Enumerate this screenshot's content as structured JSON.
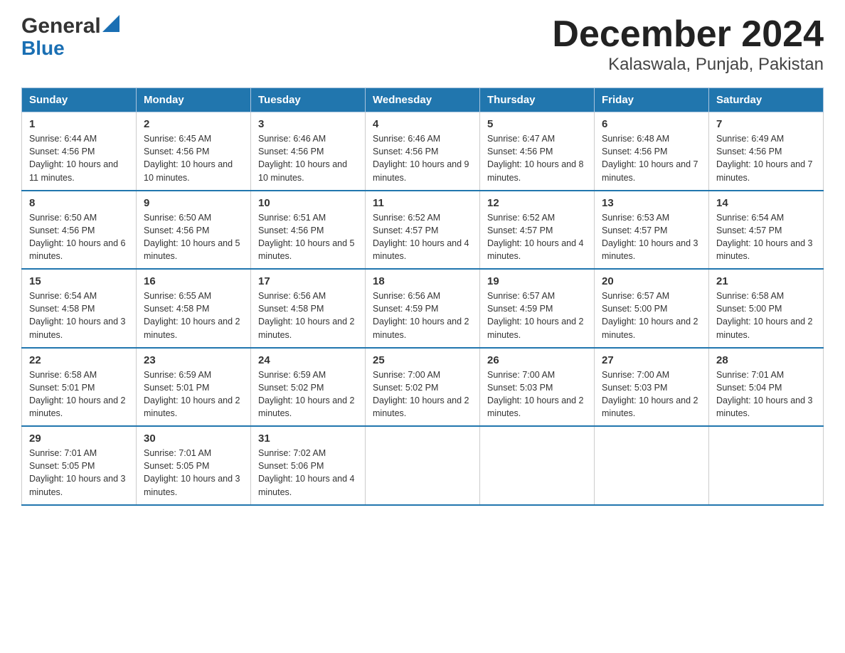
{
  "header": {
    "logo_general": "General",
    "logo_blue": "Blue",
    "title": "December 2024",
    "subtitle": "Kalaswala, Punjab, Pakistan"
  },
  "weekdays": [
    "Sunday",
    "Monday",
    "Tuesday",
    "Wednesday",
    "Thursday",
    "Friday",
    "Saturday"
  ],
  "weeks": [
    [
      {
        "day": "1",
        "sunrise": "6:44 AM",
        "sunset": "4:56 PM",
        "daylight": "10 hours and 11 minutes."
      },
      {
        "day": "2",
        "sunrise": "6:45 AM",
        "sunset": "4:56 PM",
        "daylight": "10 hours and 10 minutes."
      },
      {
        "day": "3",
        "sunrise": "6:46 AM",
        "sunset": "4:56 PM",
        "daylight": "10 hours and 10 minutes."
      },
      {
        "day": "4",
        "sunrise": "6:46 AM",
        "sunset": "4:56 PM",
        "daylight": "10 hours and 9 minutes."
      },
      {
        "day": "5",
        "sunrise": "6:47 AM",
        "sunset": "4:56 PM",
        "daylight": "10 hours and 8 minutes."
      },
      {
        "day": "6",
        "sunrise": "6:48 AM",
        "sunset": "4:56 PM",
        "daylight": "10 hours and 7 minutes."
      },
      {
        "day": "7",
        "sunrise": "6:49 AM",
        "sunset": "4:56 PM",
        "daylight": "10 hours and 7 minutes."
      }
    ],
    [
      {
        "day": "8",
        "sunrise": "6:50 AM",
        "sunset": "4:56 PM",
        "daylight": "10 hours and 6 minutes."
      },
      {
        "day": "9",
        "sunrise": "6:50 AM",
        "sunset": "4:56 PM",
        "daylight": "10 hours and 5 minutes."
      },
      {
        "day": "10",
        "sunrise": "6:51 AM",
        "sunset": "4:56 PM",
        "daylight": "10 hours and 5 minutes."
      },
      {
        "day": "11",
        "sunrise": "6:52 AM",
        "sunset": "4:57 PM",
        "daylight": "10 hours and 4 minutes."
      },
      {
        "day": "12",
        "sunrise": "6:52 AM",
        "sunset": "4:57 PM",
        "daylight": "10 hours and 4 minutes."
      },
      {
        "day": "13",
        "sunrise": "6:53 AM",
        "sunset": "4:57 PM",
        "daylight": "10 hours and 3 minutes."
      },
      {
        "day": "14",
        "sunrise": "6:54 AM",
        "sunset": "4:57 PM",
        "daylight": "10 hours and 3 minutes."
      }
    ],
    [
      {
        "day": "15",
        "sunrise": "6:54 AM",
        "sunset": "4:58 PM",
        "daylight": "10 hours and 3 minutes."
      },
      {
        "day": "16",
        "sunrise": "6:55 AM",
        "sunset": "4:58 PM",
        "daylight": "10 hours and 2 minutes."
      },
      {
        "day": "17",
        "sunrise": "6:56 AM",
        "sunset": "4:58 PM",
        "daylight": "10 hours and 2 minutes."
      },
      {
        "day": "18",
        "sunrise": "6:56 AM",
        "sunset": "4:59 PM",
        "daylight": "10 hours and 2 minutes."
      },
      {
        "day": "19",
        "sunrise": "6:57 AM",
        "sunset": "4:59 PM",
        "daylight": "10 hours and 2 minutes."
      },
      {
        "day": "20",
        "sunrise": "6:57 AM",
        "sunset": "5:00 PM",
        "daylight": "10 hours and 2 minutes."
      },
      {
        "day": "21",
        "sunrise": "6:58 AM",
        "sunset": "5:00 PM",
        "daylight": "10 hours and 2 minutes."
      }
    ],
    [
      {
        "day": "22",
        "sunrise": "6:58 AM",
        "sunset": "5:01 PM",
        "daylight": "10 hours and 2 minutes."
      },
      {
        "day": "23",
        "sunrise": "6:59 AM",
        "sunset": "5:01 PM",
        "daylight": "10 hours and 2 minutes."
      },
      {
        "day": "24",
        "sunrise": "6:59 AM",
        "sunset": "5:02 PM",
        "daylight": "10 hours and 2 minutes."
      },
      {
        "day": "25",
        "sunrise": "7:00 AM",
        "sunset": "5:02 PM",
        "daylight": "10 hours and 2 minutes."
      },
      {
        "day": "26",
        "sunrise": "7:00 AM",
        "sunset": "5:03 PM",
        "daylight": "10 hours and 2 minutes."
      },
      {
        "day": "27",
        "sunrise": "7:00 AM",
        "sunset": "5:03 PM",
        "daylight": "10 hours and 2 minutes."
      },
      {
        "day": "28",
        "sunrise": "7:01 AM",
        "sunset": "5:04 PM",
        "daylight": "10 hours and 3 minutes."
      }
    ],
    [
      {
        "day": "29",
        "sunrise": "7:01 AM",
        "sunset": "5:05 PM",
        "daylight": "10 hours and 3 minutes."
      },
      {
        "day": "30",
        "sunrise": "7:01 AM",
        "sunset": "5:05 PM",
        "daylight": "10 hours and 3 minutes."
      },
      {
        "day": "31",
        "sunrise": "7:02 AM",
        "sunset": "5:06 PM",
        "daylight": "10 hours and 4 minutes."
      },
      null,
      null,
      null,
      null
    ]
  ],
  "labels": {
    "sunrise_prefix": "Sunrise: ",
    "sunset_prefix": "Sunset: ",
    "daylight_prefix": "Daylight: "
  }
}
